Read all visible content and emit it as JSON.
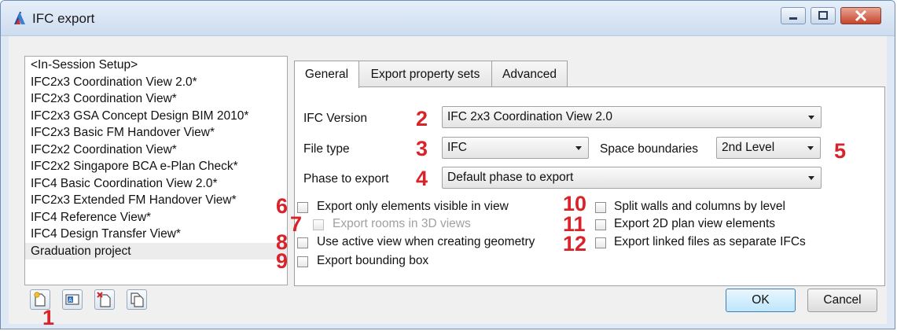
{
  "window": {
    "title": "IFC export"
  },
  "setups": [
    {
      "label": "<In-Session Setup>"
    },
    {
      "label": "IFC2x3 Coordination View 2.0*"
    },
    {
      "label": "IFC2x3 Coordination View*"
    },
    {
      "label": "IFC2x3 GSA Concept Design BIM 2010*"
    },
    {
      "label": "IFC2x3 Basic FM Handover View*"
    },
    {
      "label": "IFC2x2 Coordination View*"
    },
    {
      "label": "IFC2x2 Singapore BCA e-Plan Check*"
    },
    {
      "label": "IFC4 Basic Coordination View 2.0*"
    },
    {
      "label": "IFC2x3 Extended FM Handover View*"
    },
    {
      "label": "IFC4 Reference View*"
    },
    {
      "label": "IFC4 Design Transfer View*"
    },
    {
      "label": "Graduation project",
      "selected": true
    }
  ],
  "tabs": [
    {
      "label": "General",
      "active": true
    },
    {
      "label": "Export property sets"
    },
    {
      "label": "Advanced"
    }
  ],
  "general": {
    "ifc_version_label": "IFC Version",
    "ifc_version_value": "IFC 2x3 Coordination View 2.0",
    "file_type_label": "File type",
    "file_type_value": "IFC",
    "space_boundaries_label": "Space boundaries",
    "space_boundaries_value": "2nd Level",
    "phase_label": "Phase to export",
    "phase_value": "Default phase to export",
    "options_left": [
      {
        "label": "Export only elements visible in view",
        "checked": false,
        "enabled": true
      },
      {
        "label": "Export rooms in 3D views",
        "checked": false,
        "enabled": false
      },
      {
        "label": "Use active view when creating geometry",
        "checked": false,
        "enabled": true
      },
      {
        "label": "Export bounding box",
        "checked": false,
        "enabled": true
      }
    ],
    "options_right": [
      {
        "label": "Split walls and columns by level",
        "checked": false
      },
      {
        "label": "Export 2D plan view elements",
        "checked": false
      },
      {
        "label": "Export linked files as separate IFCs",
        "checked": false
      }
    ]
  },
  "annotations": {
    "n1": "1",
    "n2": "2",
    "n3": "3",
    "n4": "4",
    "n5": "5",
    "n6": "6",
    "n7": "7",
    "n8": "8",
    "n9": "9",
    "n10": "10",
    "n11": "11",
    "n12": "12"
  },
  "toolbar_icons": [
    "new-setup-icon",
    "rename-setup-icon",
    "delete-setup-icon",
    "duplicate-setup-icon"
  ],
  "buttons": {
    "ok": "OK",
    "cancel": "Cancel"
  },
  "colors": {
    "annotation": "#d8232a",
    "selected_row": "#ececec"
  }
}
